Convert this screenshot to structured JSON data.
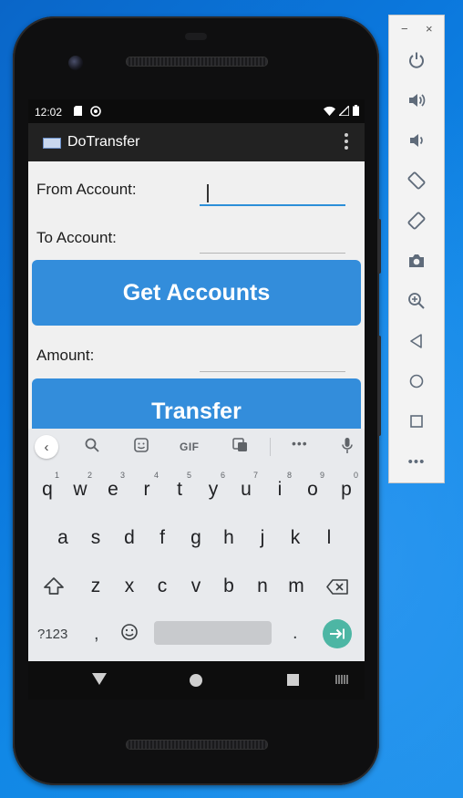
{
  "status_bar": {
    "time": "12:02"
  },
  "app_bar": {
    "title": "DoTransfer"
  },
  "form": {
    "from_label": "From Account:",
    "to_label": "To Account:",
    "amount_label": "Amount:",
    "get_accounts_button": "Get Accounts",
    "transfer_button": "Transfer",
    "from_value": "",
    "to_value": "",
    "amount_value": ""
  },
  "keyboard": {
    "toolbar": {
      "gif_label": "GIF",
      "more_label": "•••"
    },
    "row1": [
      {
        "key": "q",
        "hint": "1"
      },
      {
        "key": "w",
        "hint": "2"
      },
      {
        "key": "e",
        "hint": "3"
      },
      {
        "key": "r",
        "hint": "4"
      },
      {
        "key": "t",
        "hint": "5"
      },
      {
        "key": "y",
        "hint": "6"
      },
      {
        "key": "u",
        "hint": "7"
      },
      {
        "key": "i",
        "hint": "8"
      },
      {
        "key": "o",
        "hint": "9"
      },
      {
        "key": "p",
        "hint": "0"
      }
    ],
    "row2": [
      "a",
      "s",
      "d",
      "f",
      "g",
      "h",
      "j",
      "k",
      "l"
    ],
    "row3": [
      "z",
      "x",
      "c",
      "v",
      "b",
      "n",
      "m"
    ],
    "row4": {
      "symbols": "?123",
      "comma": ",",
      "period": "."
    }
  },
  "emulator_panel": {
    "minimize_label": "−",
    "close_label": "×",
    "more_label": "•••"
  },
  "colors": {
    "accent": "#338ddb",
    "field_focus": "#2c8fd8",
    "enter_key": "#4db6a4"
  }
}
